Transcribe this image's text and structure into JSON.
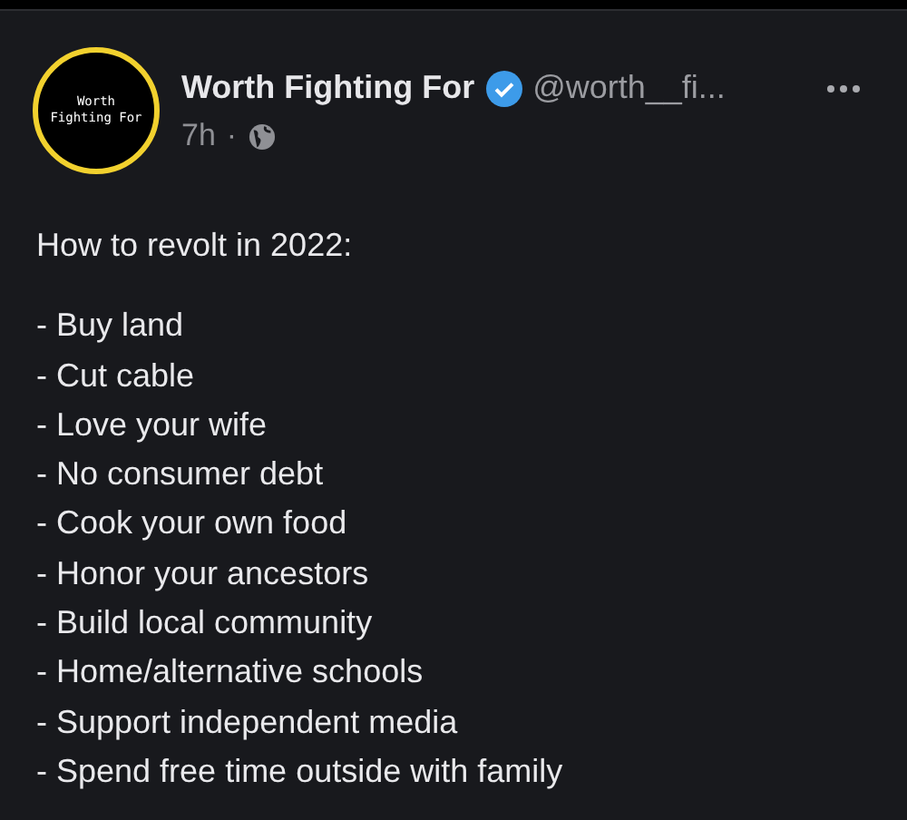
{
  "post": {
    "avatar_text": [
      "Worth",
      "Fighting For"
    ],
    "author": "Worth Fighting For",
    "verified": true,
    "handle": "@worth__fi...",
    "time": "7h",
    "separator": "·",
    "intro": "How to revolt in 2022:",
    "lines": [
      "- Buy land",
      "- Cut cable",
      "- Love your wife",
      "- No consumer debt",
      "- Cook your own food",
      "- Honor your ancestors",
      "- Build local community",
      "- Home/alternative schools",
      "- Support independent media",
      "- Spend free time outside with family"
    ]
  }
}
